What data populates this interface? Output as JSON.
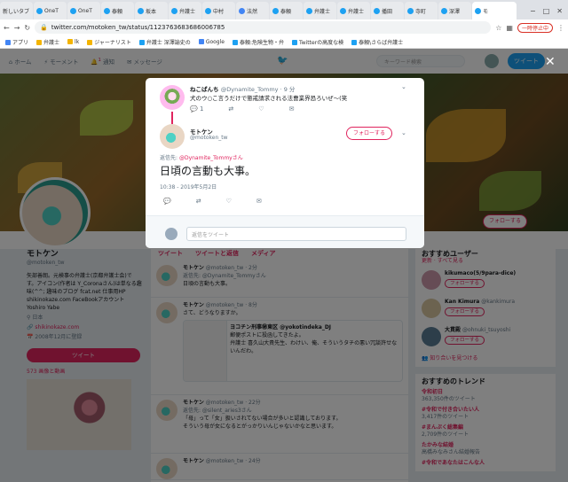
{
  "browser": {
    "tabs": [
      "新しいタブ",
      "OneT",
      "OneT",
      "泰頼",
      "坂本",
      "弁護士",
      "中村",
      "法然",
      "泰頼",
      "弁護士",
      "弁護士",
      "播田",
      "寺町",
      "深澤",
      "モ"
    ],
    "url": "twitter.com/motoken_tw/status/1123763683686006785",
    "pause_label": "一時停止中",
    "bookmarks": [
      "アプリ",
      "弁護士",
      "lk",
      "ジャーナリスト",
      "弁護士 深澤諭史の",
      "Google",
      "泰頼:危険生物・弁",
      "Twitterの高度な検",
      "泰頼\\さらば弁護士"
    ]
  },
  "twitter_nav": {
    "home": "ホーム",
    "moments": "モーメント",
    "notifications": "通知",
    "notif_badge": "1",
    "messages": "メッセージ",
    "search_placeholder": "キーワード検索",
    "tweet_button": "ツイート"
  },
  "profile": {
    "name": "モトケン",
    "handle": "@motoken_tw",
    "bio": "矢部善朗。元検事の弁護士(京都弁護士会)です。アイコン(作者は Y_Coronaさん)は単なる趣味(^^; 趣味のブログ fcat.net 仕事用HP shikinokaze.com FaceBookアカウント Yoshiro Yabe",
    "location": "日本",
    "website": "shikinokaze.com",
    "joined": "2008年12月に登録",
    "tweet_button": "ツイート",
    "media": "573 画像と動画",
    "follow_button": "フォローする"
  },
  "timeline": {
    "tabs": [
      "ツイート",
      "ツイートと返信",
      "メディア"
    ],
    "items": [
      {
        "name": "モトケン",
        "sub": "@motoken_tw · 2分",
        "reply_to": "返信先: @Dynamite_Tommyさん",
        "text": "日頃の言動も大事。"
      },
      {
        "name": "モトケン",
        "sub": "@motoken_tw · 8分",
        "text": "さて、どうなりますか。",
        "quote_name": "ヨコチン刑事㊙東区 @yokotindeka_DJ",
        "quote_text": "郵便ポストに投函してきたよ。",
        "quote_text2": "弁護士 喜久山大貴先生、わけい、俺、そういうタチの悪い冗談許せないんだわ。"
      },
      {
        "name": "モトケン",
        "sub": "@motoken_tw · 22分",
        "reply_to": "返信先: @silent_aries3さん",
        "text": "「母」って「女」扱いされてない場合が多いと認識しております。",
        "text2": "そういう母が女になるとがっかりいんじゃないかなと思います。"
      },
      {
        "name": "モトケン",
        "sub": "@motoken_tw · 24分"
      }
    ]
  },
  "right": {
    "suggest_title": "おすすめユーザー",
    "suggest_links": "更新 · すべて見る",
    "users": [
      {
        "name": "kikumaco(5/9para-dice)",
        "handle": "",
        "button": "フォローする"
      },
      {
        "name": "Kan Kimura",
        "handle": "@kankimura",
        "button": "フォローする"
      },
      {
        "name": "大貫殿",
        "handle": "@ohnuki_tsuyoshi",
        "button": "フォローする"
      }
    ],
    "find_friends": "知り合いを見つける",
    "trends_title": "おすすめのトレンド",
    "trends": [
      {
        "name": "令和初日",
        "count": "363,350件のツイート"
      },
      {
        "name": "#令和で付き合いたい人",
        "count": "3,417件のツイート"
      },
      {
        "name": "#まんぷく総集編",
        "count": "2,709件のツイート"
      },
      {
        "name": "たかみな結婚",
        "count": "高橋みなみさん結婚報告"
      },
      {
        "name": "#令和であなたはこんな人",
        "count": ""
      }
    ]
  },
  "modal": {
    "parent_name": "ねこぱんち",
    "parent_handle": "@Dynamite_Tommy · 9 分",
    "parent_text": "犬のウ○こ言うだけで懲戒請求される法曹業界恐ろいぜ〜(笑",
    "parent_reply_count": "1",
    "main_name": "モトケン",
    "main_handle": "@motoken_tw",
    "follow_button": "フォローする",
    "reply_to_prefix": "返信先:",
    "reply_to_user": "@Dynamite_Tommyさん",
    "body": "日頃の言動も大事。",
    "date": "10:38 - 2019年5月2日",
    "reply_placeholder": "返信をツイート"
  }
}
